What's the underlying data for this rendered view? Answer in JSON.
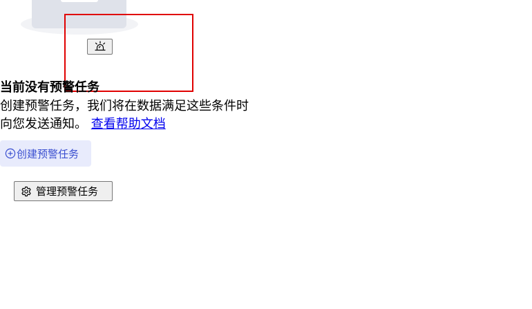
{
  "empty_state": {
    "title": "当前没有预警任务",
    "description": "创建预警任务，我们将在数据满足这些条件时向您发送通知。",
    "help_link": "查看帮助文档"
  },
  "actions": {
    "create_label": "创建预警任务",
    "manage_label": "管理预警任务"
  },
  "icons": {
    "alarm": "alarm-icon",
    "create": "plus-circle-icon",
    "manage": "gear-icon"
  },
  "colors": {
    "highlight": "#e00000",
    "create_bg": "#e8ebfc",
    "create_text": "#3a4fd0",
    "link": "#0000ee",
    "illustration": "#dfe2ea"
  }
}
